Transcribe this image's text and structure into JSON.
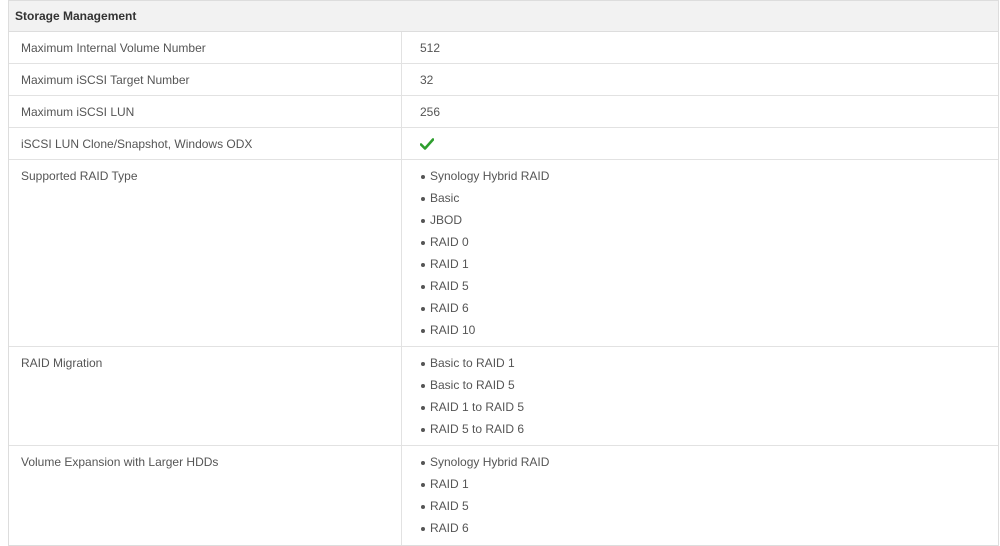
{
  "section": {
    "title": "Storage Management"
  },
  "rows": [
    {
      "label": "Maximum Internal Volume Number",
      "value": "512"
    },
    {
      "label": "Maximum iSCSI Target Number",
      "value": "32"
    },
    {
      "label": "Maximum iSCSI LUN",
      "value": "256"
    },
    {
      "label": "iSCSI LUN Clone/Snapshot, Windows ODX",
      "value_icon": "checkmark-icon",
      "check_color": "#2e9e2e"
    },
    {
      "label": "Supported RAID Type",
      "items": [
        "Synology Hybrid RAID",
        "Basic",
        "JBOD",
        "RAID 0",
        "RAID 1",
        "RAID 5",
        "RAID 6",
        "RAID 10"
      ]
    },
    {
      "label": "RAID Migration",
      "items": [
        "Basic to RAID 1",
        "Basic to RAID 5",
        "RAID 1 to RAID 5",
        "RAID 5 to RAID 6"
      ]
    },
    {
      "label": "Volume Expansion with Larger HDDs",
      "items": [
        "Synology Hybrid RAID",
        "RAID 1",
        "RAID 5",
        "RAID 6"
      ]
    }
  ]
}
